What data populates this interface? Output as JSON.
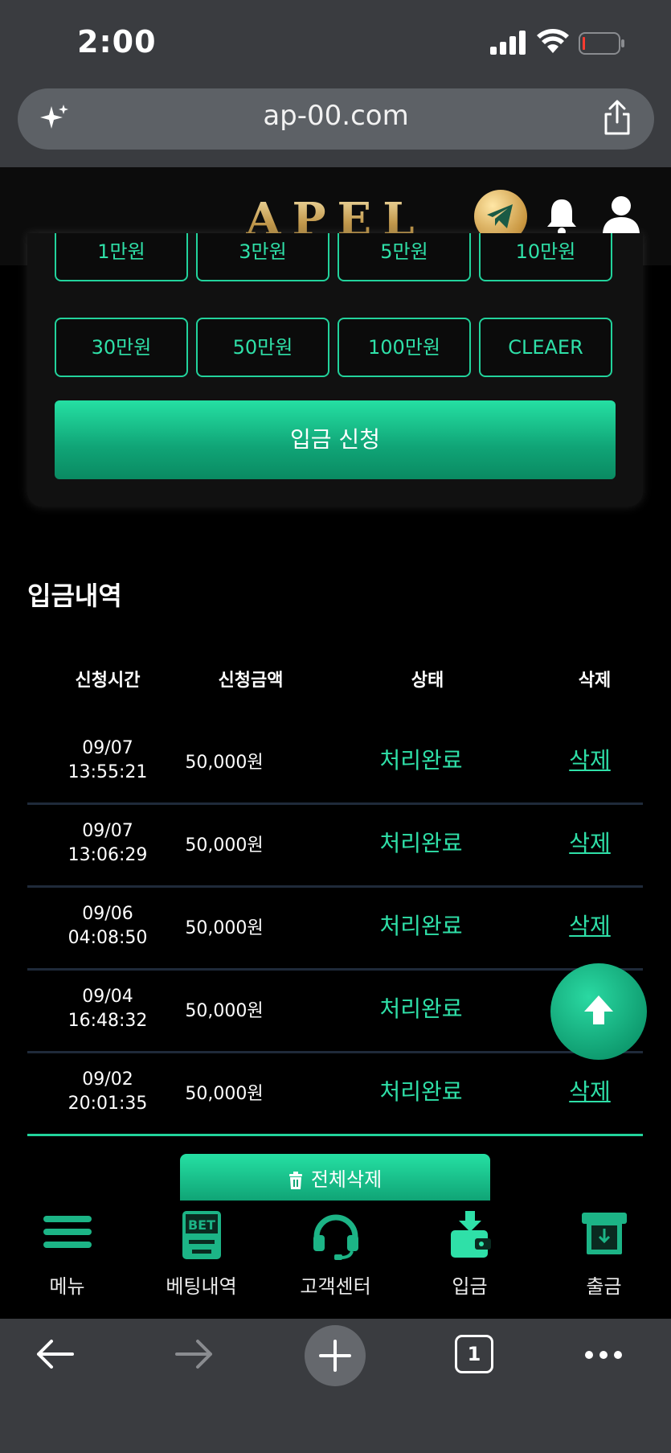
{
  "status_bar": {
    "time": "2:00"
  },
  "browser": {
    "url": "ap-00.com",
    "tab_count": "1"
  },
  "header": {
    "logo_text": "APEL"
  },
  "deposit_panel": {
    "amount_buttons": [
      "1만원",
      "3만원",
      "5만원",
      "10만원",
      "30만원",
      "50만원",
      "100만원",
      "CLEAER"
    ],
    "apply_label": "입금 신청"
  },
  "history": {
    "title": "입금내역",
    "columns": [
      "신청시간",
      "신청금액",
      "상태",
      "삭제"
    ],
    "rows": [
      {
        "date": "09/07",
        "time": "13:55:21",
        "amount": "50,000원",
        "status": "처리완료",
        "action": "삭제"
      },
      {
        "date": "09/07",
        "time": "13:06:29",
        "amount": "50,000원",
        "status": "처리완료",
        "action": "삭제"
      },
      {
        "date": "09/06",
        "time": "04:08:50",
        "amount": "50,000원",
        "status": "처리완료",
        "action": "삭제"
      },
      {
        "date": "09/04",
        "time": "16:48:32",
        "amount": "50,000원",
        "status": "처리완료",
        "action": "삭제"
      },
      {
        "date": "09/02",
        "time": "20:01:35",
        "amount": "50,000원",
        "status": "처리완료",
        "action": "삭제"
      }
    ],
    "delete_all_label": "전체삭제"
  },
  "bottom_nav": [
    {
      "label": "메뉴",
      "icon": "menu-icon"
    },
    {
      "label": "베팅내역",
      "icon": "bet-history-icon"
    },
    {
      "label": "고객센터",
      "icon": "headset-icon"
    },
    {
      "label": "입금",
      "icon": "deposit-wallet-icon"
    },
    {
      "label": "출금",
      "icon": "withdraw-icon"
    }
  ],
  "colors": {
    "accent": "#22d39c",
    "gold": "#d4b06a",
    "chrome": "#3a3c40"
  }
}
